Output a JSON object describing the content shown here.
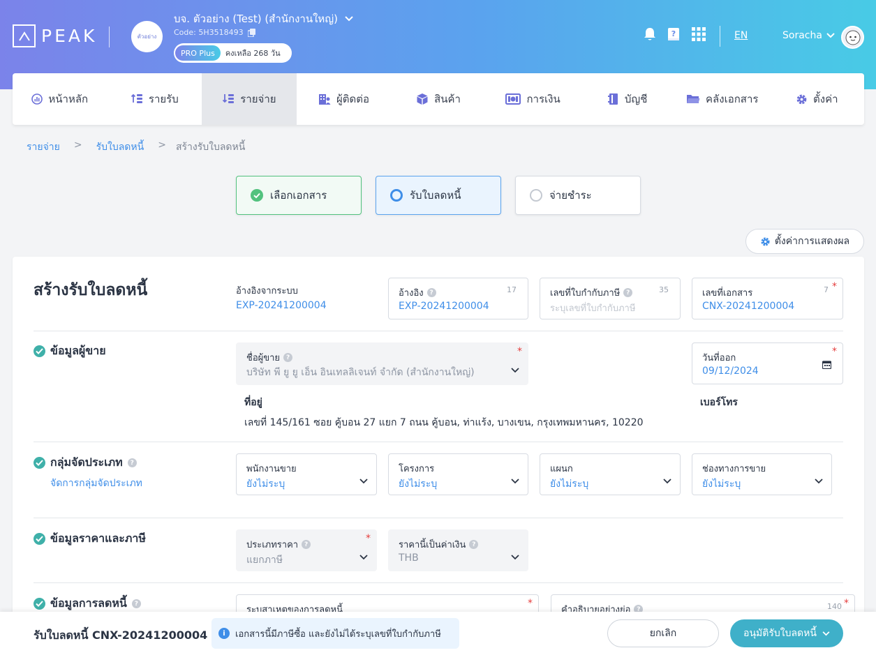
{
  "header": {
    "logo_text": "PEAK",
    "company_avatar_text": "ตัวอย่าง",
    "company_name": "บจ. ตัวอย่าง (Test) (สำนักงานใหญ่)",
    "company_code": "Code: 5H3518493",
    "plan": "PRO Plus",
    "days_left": "คงเหลือ 268 วัน",
    "lang": "EN",
    "user": "Soracha"
  },
  "nav": [
    {
      "label": "หน้าหลัก",
      "icon": "dashboard-icon"
    },
    {
      "label": "รายรับ",
      "icon": "income-icon"
    },
    {
      "label": "รายจ่าย",
      "icon": "expense-icon"
    },
    {
      "label": "ผู้ติดต่อ",
      "icon": "contacts-icon"
    },
    {
      "label": "สินค้า",
      "icon": "product-icon"
    },
    {
      "label": "การเงิน",
      "icon": "money-icon"
    },
    {
      "label": "บัญชี",
      "icon": "account-book-icon"
    },
    {
      "label": "คลังเอกสาร",
      "icon": "folder-icon"
    },
    {
      "label": "ตั้งค่า",
      "icon": "gear-icon"
    }
  ],
  "breadcrumb": {
    "items": [
      "รายจ่าย",
      "รับใบลดหนี้",
      "สร้างรับใบลดหนี้"
    ],
    "sep": ">"
  },
  "steps": [
    "เลือกเอกสาร",
    "รับใบลดหนี้",
    "จ่ายชำระ"
  ],
  "display_settings": "ตั้งค่าการแสดงผล",
  "form": {
    "title": "สร้างรับใบลดหนี้",
    "system_ref_label": "อ้างอิงจากระบบ",
    "system_ref_value": "EXP-20241200004",
    "ref": {
      "label": "อ้างอิง",
      "count": "17",
      "value": "EXP-20241200004"
    },
    "tax_invoice": {
      "label": "เลขที่ใบกำกับภาษี",
      "count": "35",
      "placeholder": "ระบุเลขที่ใบกำกับภาษี"
    },
    "doc_no": {
      "label": "เลขที่เอกสาร",
      "count": "7",
      "value": "CNX-20241200004"
    },
    "seller_section": "ข้อมูลผู้ขาย",
    "seller": {
      "label": "ชื่อผู้ขาย",
      "value": "บริษัท พี ยู ยู เอ็น อินเทลลิเจนท์ จำกัด (สำนักงานใหญ่)"
    },
    "issue_date": {
      "label": "วันที่ออก",
      "value": "09/12/2024"
    },
    "address_label": "ที่อยู่",
    "address_value": "เลขที่ 145/161 ซอย คู้บอน 27 แยก 7 ถนน คู้บอน, ท่าแร้ง, บางเขน, กรุงเทพมหานคร, 10220",
    "phone_label": "เบอร์โทร",
    "group_section": "กลุ่มจัดประเภท",
    "group_manage": "จัดการกลุ่มจัดประเภท",
    "groups": [
      {
        "label": "พนักงานขาย",
        "value": "ยังไม่ระบุ"
      },
      {
        "label": "โครงการ",
        "value": "ยังไม่ระบุ"
      },
      {
        "label": "แผนก",
        "value": "ยังไม่ระบุ"
      },
      {
        "label": "ช่องทางการขาย",
        "value": "ยังไม่ระบุ"
      }
    ],
    "price_section": "ข้อมูลราคาและภาษี",
    "price_type": {
      "label": "ประเภทราคา",
      "value": "แยกภาษี"
    },
    "currency": {
      "label": "ราคานี้เป็นค่าเงิน",
      "value": "THB"
    },
    "discount_section": "ข้อมูลการลดหนี้",
    "reason_label": "ระบุสาเหตุของการลดหนี้",
    "desc_label": "คำอธิบายอย่างย่อ",
    "desc_count": "140"
  },
  "footer": {
    "title": "รับใบลดหนี้ CNX-20241200004",
    "note": "เอกสารนี้มีภาษีซื้อ และยังไม่ได้ระบุเลขที่ใบกำกับภาษี",
    "cancel": "ยกเลิก",
    "approve": "อนุมัติรับใบลดหนี้"
  },
  "colors": {
    "accent": "#3f8ee8",
    "success": "#52c27e",
    "teal": "#3fb0c9",
    "required": "#e53e3e"
  }
}
